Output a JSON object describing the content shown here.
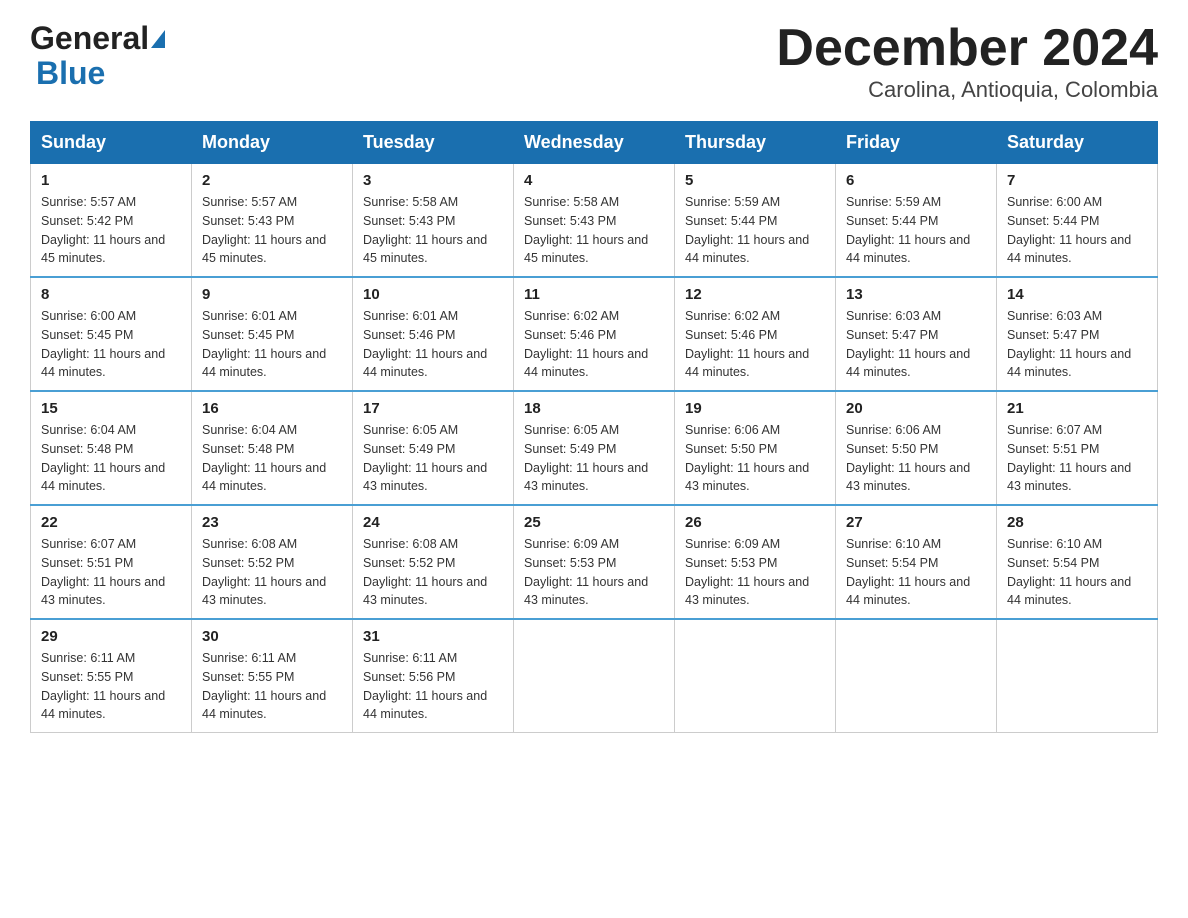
{
  "header": {
    "logo": {
      "general": "General",
      "blue": "Blue",
      "arrow": "▶"
    },
    "title": "December 2024",
    "subtitle": "Carolina, Antioquia, Colombia"
  },
  "columns": [
    "Sunday",
    "Monday",
    "Tuesday",
    "Wednesday",
    "Thursday",
    "Friday",
    "Saturday"
  ],
  "weeks": [
    [
      {
        "day": "1",
        "sunrise": "Sunrise: 5:57 AM",
        "sunset": "Sunset: 5:42 PM",
        "daylight": "Daylight: 11 hours and 45 minutes."
      },
      {
        "day": "2",
        "sunrise": "Sunrise: 5:57 AM",
        "sunset": "Sunset: 5:43 PM",
        "daylight": "Daylight: 11 hours and 45 minutes."
      },
      {
        "day": "3",
        "sunrise": "Sunrise: 5:58 AM",
        "sunset": "Sunset: 5:43 PM",
        "daylight": "Daylight: 11 hours and 45 minutes."
      },
      {
        "day": "4",
        "sunrise": "Sunrise: 5:58 AM",
        "sunset": "Sunset: 5:43 PM",
        "daylight": "Daylight: 11 hours and 45 minutes."
      },
      {
        "day": "5",
        "sunrise": "Sunrise: 5:59 AM",
        "sunset": "Sunset: 5:44 PM",
        "daylight": "Daylight: 11 hours and 44 minutes."
      },
      {
        "day": "6",
        "sunrise": "Sunrise: 5:59 AM",
        "sunset": "Sunset: 5:44 PM",
        "daylight": "Daylight: 11 hours and 44 minutes."
      },
      {
        "day": "7",
        "sunrise": "Sunrise: 6:00 AM",
        "sunset": "Sunset: 5:44 PM",
        "daylight": "Daylight: 11 hours and 44 minutes."
      }
    ],
    [
      {
        "day": "8",
        "sunrise": "Sunrise: 6:00 AM",
        "sunset": "Sunset: 5:45 PM",
        "daylight": "Daylight: 11 hours and 44 minutes."
      },
      {
        "day": "9",
        "sunrise": "Sunrise: 6:01 AM",
        "sunset": "Sunset: 5:45 PM",
        "daylight": "Daylight: 11 hours and 44 minutes."
      },
      {
        "day": "10",
        "sunrise": "Sunrise: 6:01 AM",
        "sunset": "Sunset: 5:46 PM",
        "daylight": "Daylight: 11 hours and 44 minutes."
      },
      {
        "day": "11",
        "sunrise": "Sunrise: 6:02 AM",
        "sunset": "Sunset: 5:46 PM",
        "daylight": "Daylight: 11 hours and 44 minutes."
      },
      {
        "day": "12",
        "sunrise": "Sunrise: 6:02 AM",
        "sunset": "Sunset: 5:46 PM",
        "daylight": "Daylight: 11 hours and 44 minutes."
      },
      {
        "day": "13",
        "sunrise": "Sunrise: 6:03 AM",
        "sunset": "Sunset: 5:47 PM",
        "daylight": "Daylight: 11 hours and 44 minutes."
      },
      {
        "day": "14",
        "sunrise": "Sunrise: 6:03 AM",
        "sunset": "Sunset: 5:47 PM",
        "daylight": "Daylight: 11 hours and 44 minutes."
      }
    ],
    [
      {
        "day": "15",
        "sunrise": "Sunrise: 6:04 AM",
        "sunset": "Sunset: 5:48 PM",
        "daylight": "Daylight: 11 hours and 44 minutes."
      },
      {
        "day": "16",
        "sunrise": "Sunrise: 6:04 AM",
        "sunset": "Sunset: 5:48 PM",
        "daylight": "Daylight: 11 hours and 44 minutes."
      },
      {
        "day": "17",
        "sunrise": "Sunrise: 6:05 AM",
        "sunset": "Sunset: 5:49 PM",
        "daylight": "Daylight: 11 hours and 43 minutes."
      },
      {
        "day": "18",
        "sunrise": "Sunrise: 6:05 AM",
        "sunset": "Sunset: 5:49 PM",
        "daylight": "Daylight: 11 hours and 43 minutes."
      },
      {
        "day": "19",
        "sunrise": "Sunrise: 6:06 AM",
        "sunset": "Sunset: 5:50 PM",
        "daylight": "Daylight: 11 hours and 43 minutes."
      },
      {
        "day": "20",
        "sunrise": "Sunrise: 6:06 AM",
        "sunset": "Sunset: 5:50 PM",
        "daylight": "Daylight: 11 hours and 43 minutes."
      },
      {
        "day": "21",
        "sunrise": "Sunrise: 6:07 AM",
        "sunset": "Sunset: 5:51 PM",
        "daylight": "Daylight: 11 hours and 43 minutes."
      }
    ],
    [
      {
        "day": "22",
        "sunrise": "Sunrise: 6:07 AM",
        "sunset": "Sunset: 5:51 PM",
        "daylight": "Daylight: 11 hours and 43 minutes."
      },
      {
        "day": "23",
        "sunrise": "Sunrise: 6:08 AM",
        "sunset": "Sunset: 5:52 PM",
        "daylight": "Daylight: 11 hours and 43 minutes."
      },
      {
        "day": "24",
        "sunrise": "Sunrise: 6:08 AM",
        "sunset": "Sunset: 5:52 PM",
        "daylight": "Daylight: 11 hours and 43 minutes."
      },
      {
        "day": "25",
        "sunrise": "Sunrise: 6:09 AM",
        "sunset": "Sunset: 5:53 PM",
        "daylight": "Daylight: 11 hours and 43 minutes."
      },
      {
        "day": "26",
        "sunrise": "Sunrise: 6:09 AM",
        "sunset": "Sunset: 5:53 PM",
        "daylight": "Daylight: 11 hours and 43 minutes."
      },
      {
        "day": "27",
        "sunrise": "Sunrise: 6:10 AM",
        "sunset": "Sunset: 5:54 PM",
        "daylight": "Daylight: 11 hours and 44 minutes."
      },
      {
        "day": "28",
        "sunrise": "Sunrise: 6:10 AM",
        "sunset": "Sunset: 5:54 PM",
        "daylight": "Daylight: 11 hours and 44 minutes."
      }
    ],
    [
      {
        "day": "29",
        "sunrise": "Sunrise: 6:11 AM",
        "sunset": "Sunset: 5:55 PM",
        "daylight": "Daylight: 11 hours and 44 minutes."
      },
      {
        "day": "30",
        "sunrise": "Sunrise: 6:11 AM",
        "sunset": "Sunset: 5:55 PM",
        "daylight": "Daylight: 11 hours and 44 minutes."
      },
      {
        "day": "31",
        "sunrise": "Sunrise: 6:11 AM",
        "sunset": "Sunset: 5:56 PM",
        "daylight": "Daylight: 11 hours and 44 minutes."
      },
      null,
      null,
      null,
      null
    ]
  ]
}
